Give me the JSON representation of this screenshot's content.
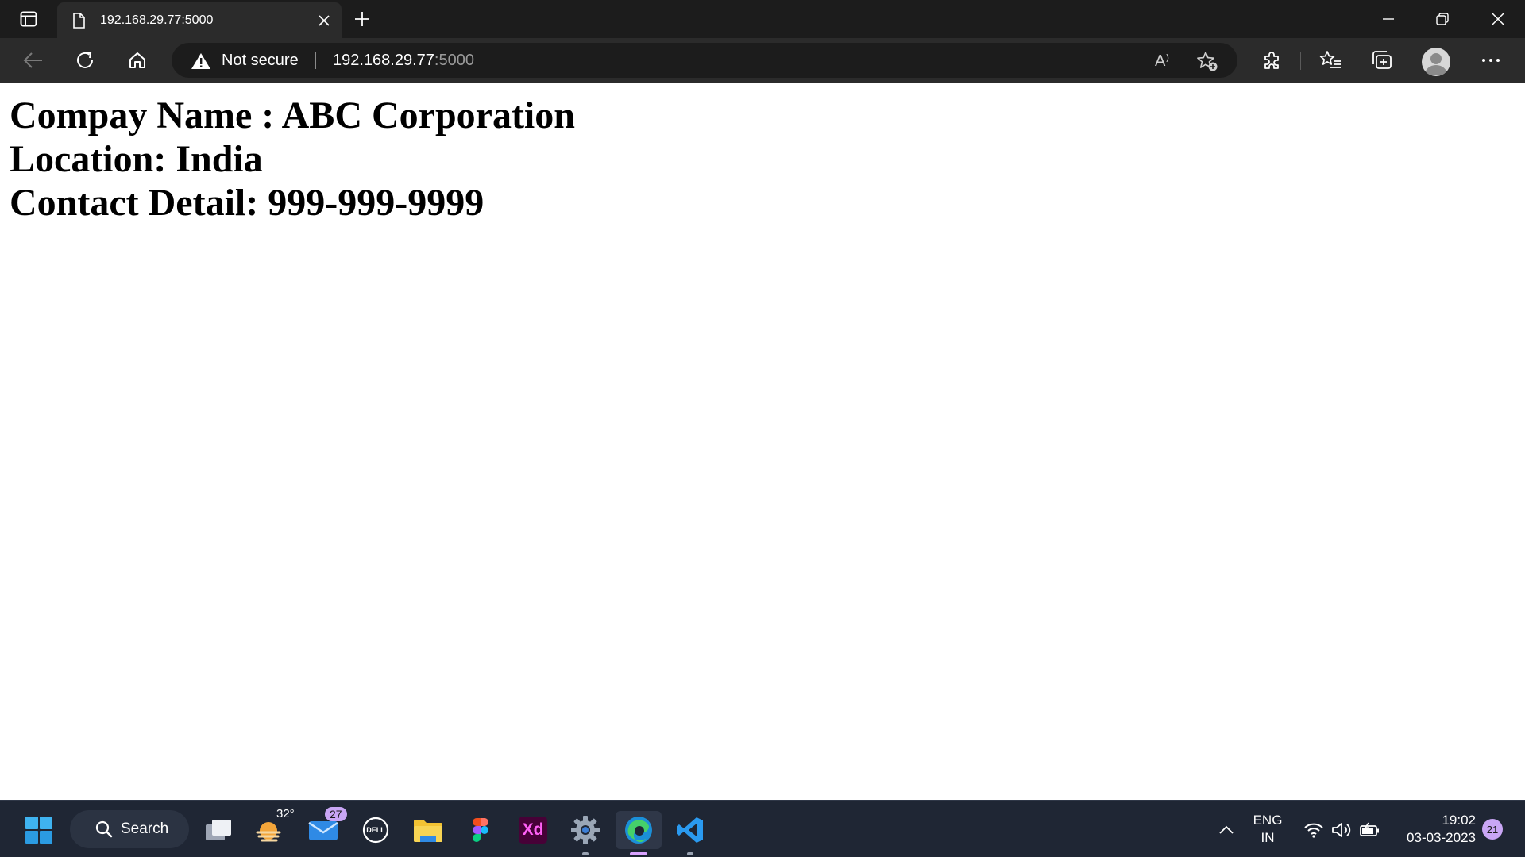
{
  "browser": {
    "tab": {
      "title": "192.168.29.77:5000"
    },
    "address_bar": {
      "security_label": "Not secure",
      "url_host": "192.168.29.77",
      "url_port": ":5000",
      "read_aloud_label": "A⁾"
    }
  },
  "page": {
    "lines": [
      "Compay Name : ABC Corporation",
      "Location: India",
      "Contact Detail: 999-999-9999"
    ]
  },
  "taskbar": {
    "search_label": "Search",
    "weather_temp": "32°",
    "mail_badge": "27",
    "xd_label": "Xd",
    "dell_label": "DELL",
    "language_line1": "ENG",
    "language_line2": "IN",
    "time": "19:02",
    "date": "03-03-2023",
    "notification_count": "21"
  },
  "colors": {
    "titlebar": "#1c1c1c",
    "toolbar": "#2b2b2b",
    "taskbar": "#1f2634",
    "accent_badge": "#c9a6f5"
  }
}
